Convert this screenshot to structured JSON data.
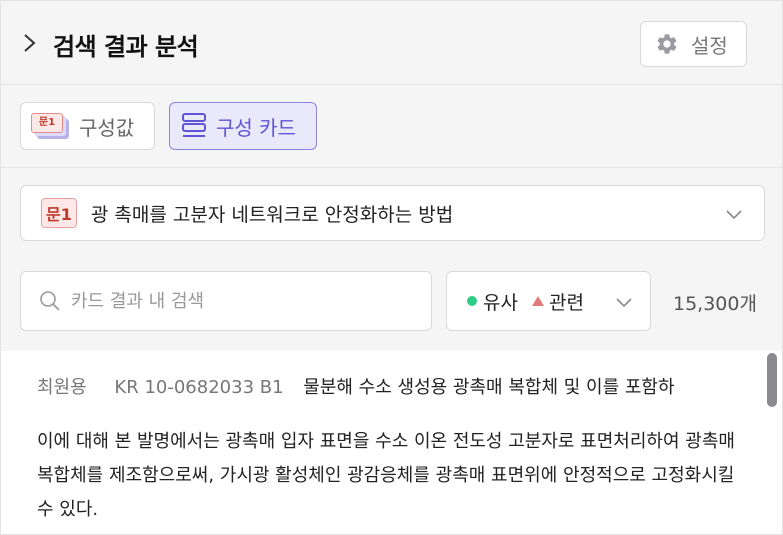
{
  "header": {
    "title": "검색 결과 분석",
    "settings_label": "설정"
  },
  "tabs": [
    {
      "label": "구성값",
      "badge": "문1"
    },
    {
      "label": "구성 카드"
    }
  ],
  "question": {
    "badge": "문1",
    "text": "광 촉매를 고분자 네트워크로 안정화하는 방법"
  },
  "search": {
    "placeholder": "카드 결과 내 검색"
  },
  "filter": {
    "similar_label": "유사",
    "related_label": "관련",
    "colors": {
      "similar": "#2ecc87",
      "related": "#e27b7b"
    }
  },
  "count": "15,300개",
  "result": {
    "author": "최원용",
    "patent_number": "KR 10-0682033 B1",
    "title": "물분해 수소 생성용 광촉매 복합체 및 이를 포함하",
    "abstract": "이에 대해 본 발명에서는 광촉매 입자 표면을 수소 이온 전도성 고분자로 표면처리하여 광촉매 복합체를 제조함으로써, 가시광 활성체인 광감응체를 광촉매 표면위에 안정적으로 고정화시킬 수 있다."
  },
  "colors": {
    "accent": "#5f55d6",
    "accent_bg": "#eae8fb",
    "badge_red": "#c0392b"
  }
}
